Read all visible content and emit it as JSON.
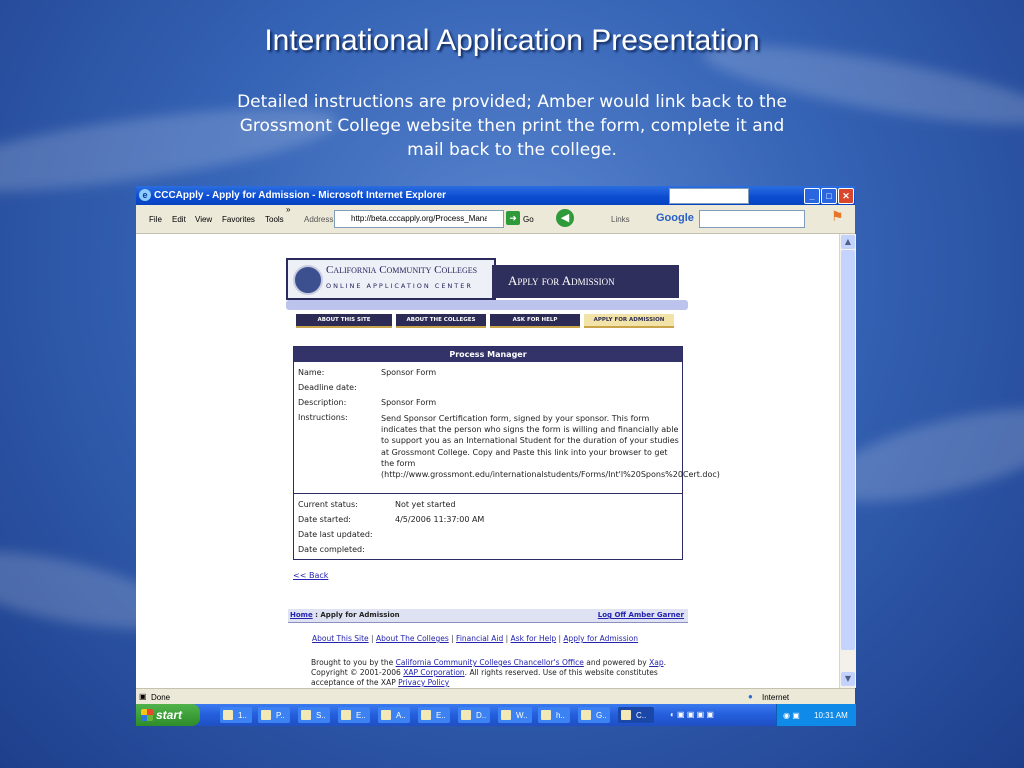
{
  "slide": {
    "title": "International Application Presentation",
    "subtitle": "Detailed instructions are provided; Amber would link back to the Grossmont College website then print the form, complete it and mail back to the college."
  },
  "window": {
    "title": "CCCApply - Apply for Admission - Microsoft Internet Explorer",
    "menu": [
      "File",
      "Edit",
      "View",
      "Favorites",
      "Tools"
    ],
    "chevron": "»",
    "address_label": "Address",
    "address_url": "http://beta.cccapply.org/Process_Manag",
    "go_label": "Go",
    "links_label": "Links",
    "google_label": "Google",
    "status_text": "Done",
    "zone_text": "Internet"
  },
  "page": {
    "logo_main": "California Community Colleges",
    "logo_sub": "ONLINE APPLICATION CENTER",
    "banner": "Apply for Admission",
    "nav": [
      "ABOUT THIS SITE",
      "ABOUT THE COLLEGES",
      "ASK FOR HELP",
      "APPLY FOR ADMISSION"
    ],
    "process_manager": {
      "header": "Process Manager",
      "name_label": "Name:",
      "name_value": "Sponsor Form",
      "deadline_label": "Deadline date:",
      "description_label": "Description:",
      "description_value": "Sponsor Form",
      "instructions_label": "Instructions:",
      "instructions_value": "Send Sponsor Certification form, signed by your sponsor. This form indicates that the person who signs the form is willing and financially able to support you as an International Student for the duration of your studies at Grossmont College. Copy and Paste this link into your browser to get the form (http://www.grossmont.edu/internationalstudents/Forms/Int'l%20Spons%20Cert.doc)",
      "status_label": "Current status:",
      "status_value": "Not yet started",
      "started_label": "Date started:",
      "started_value": "4/5/2006 11:37:00 AM",
      "updated_label": "Date last updated:",
      "completed_label": "Date completed:"
    },
    "back_link": "<< Back",
    "crumb_home": "Home",
    "crumb_rest": " : Apply for Admission",
    "logoff": "Log Off Amber Garner",
    "footer_links": [
      "About This Site",
      "About The Colleges",
      "Financial Aid",
      "Ask for Help",
      "Apply for Admission"
    ],
    "credits_1": "Brought to you by the ",
    "credits_link1": "California Community Colleges Chancellor's Office",
    "credits_2": " and powered by ",
    "credits_link2": "Xap",
    "credits_3": ". Copyright © 2001-2006 ",
    "credits_link3": "XAP Corporation",
    "credits_4": ". All rights reserved. Use of this website constitutes acceptance of the XAP ",
    "credits_link4": "Privacy Policy"
  },
  "taskbar": {
    "start_label": "start",
    "tasks": [
      "1..",
      "P..",
      "S..",
      "E..",
      "A..",
      "E..",
      "D..",
      "W..",
      "h..",
      "G..",
      "C.."
    ],
    "clock": "10:31 AM"
  }
}
